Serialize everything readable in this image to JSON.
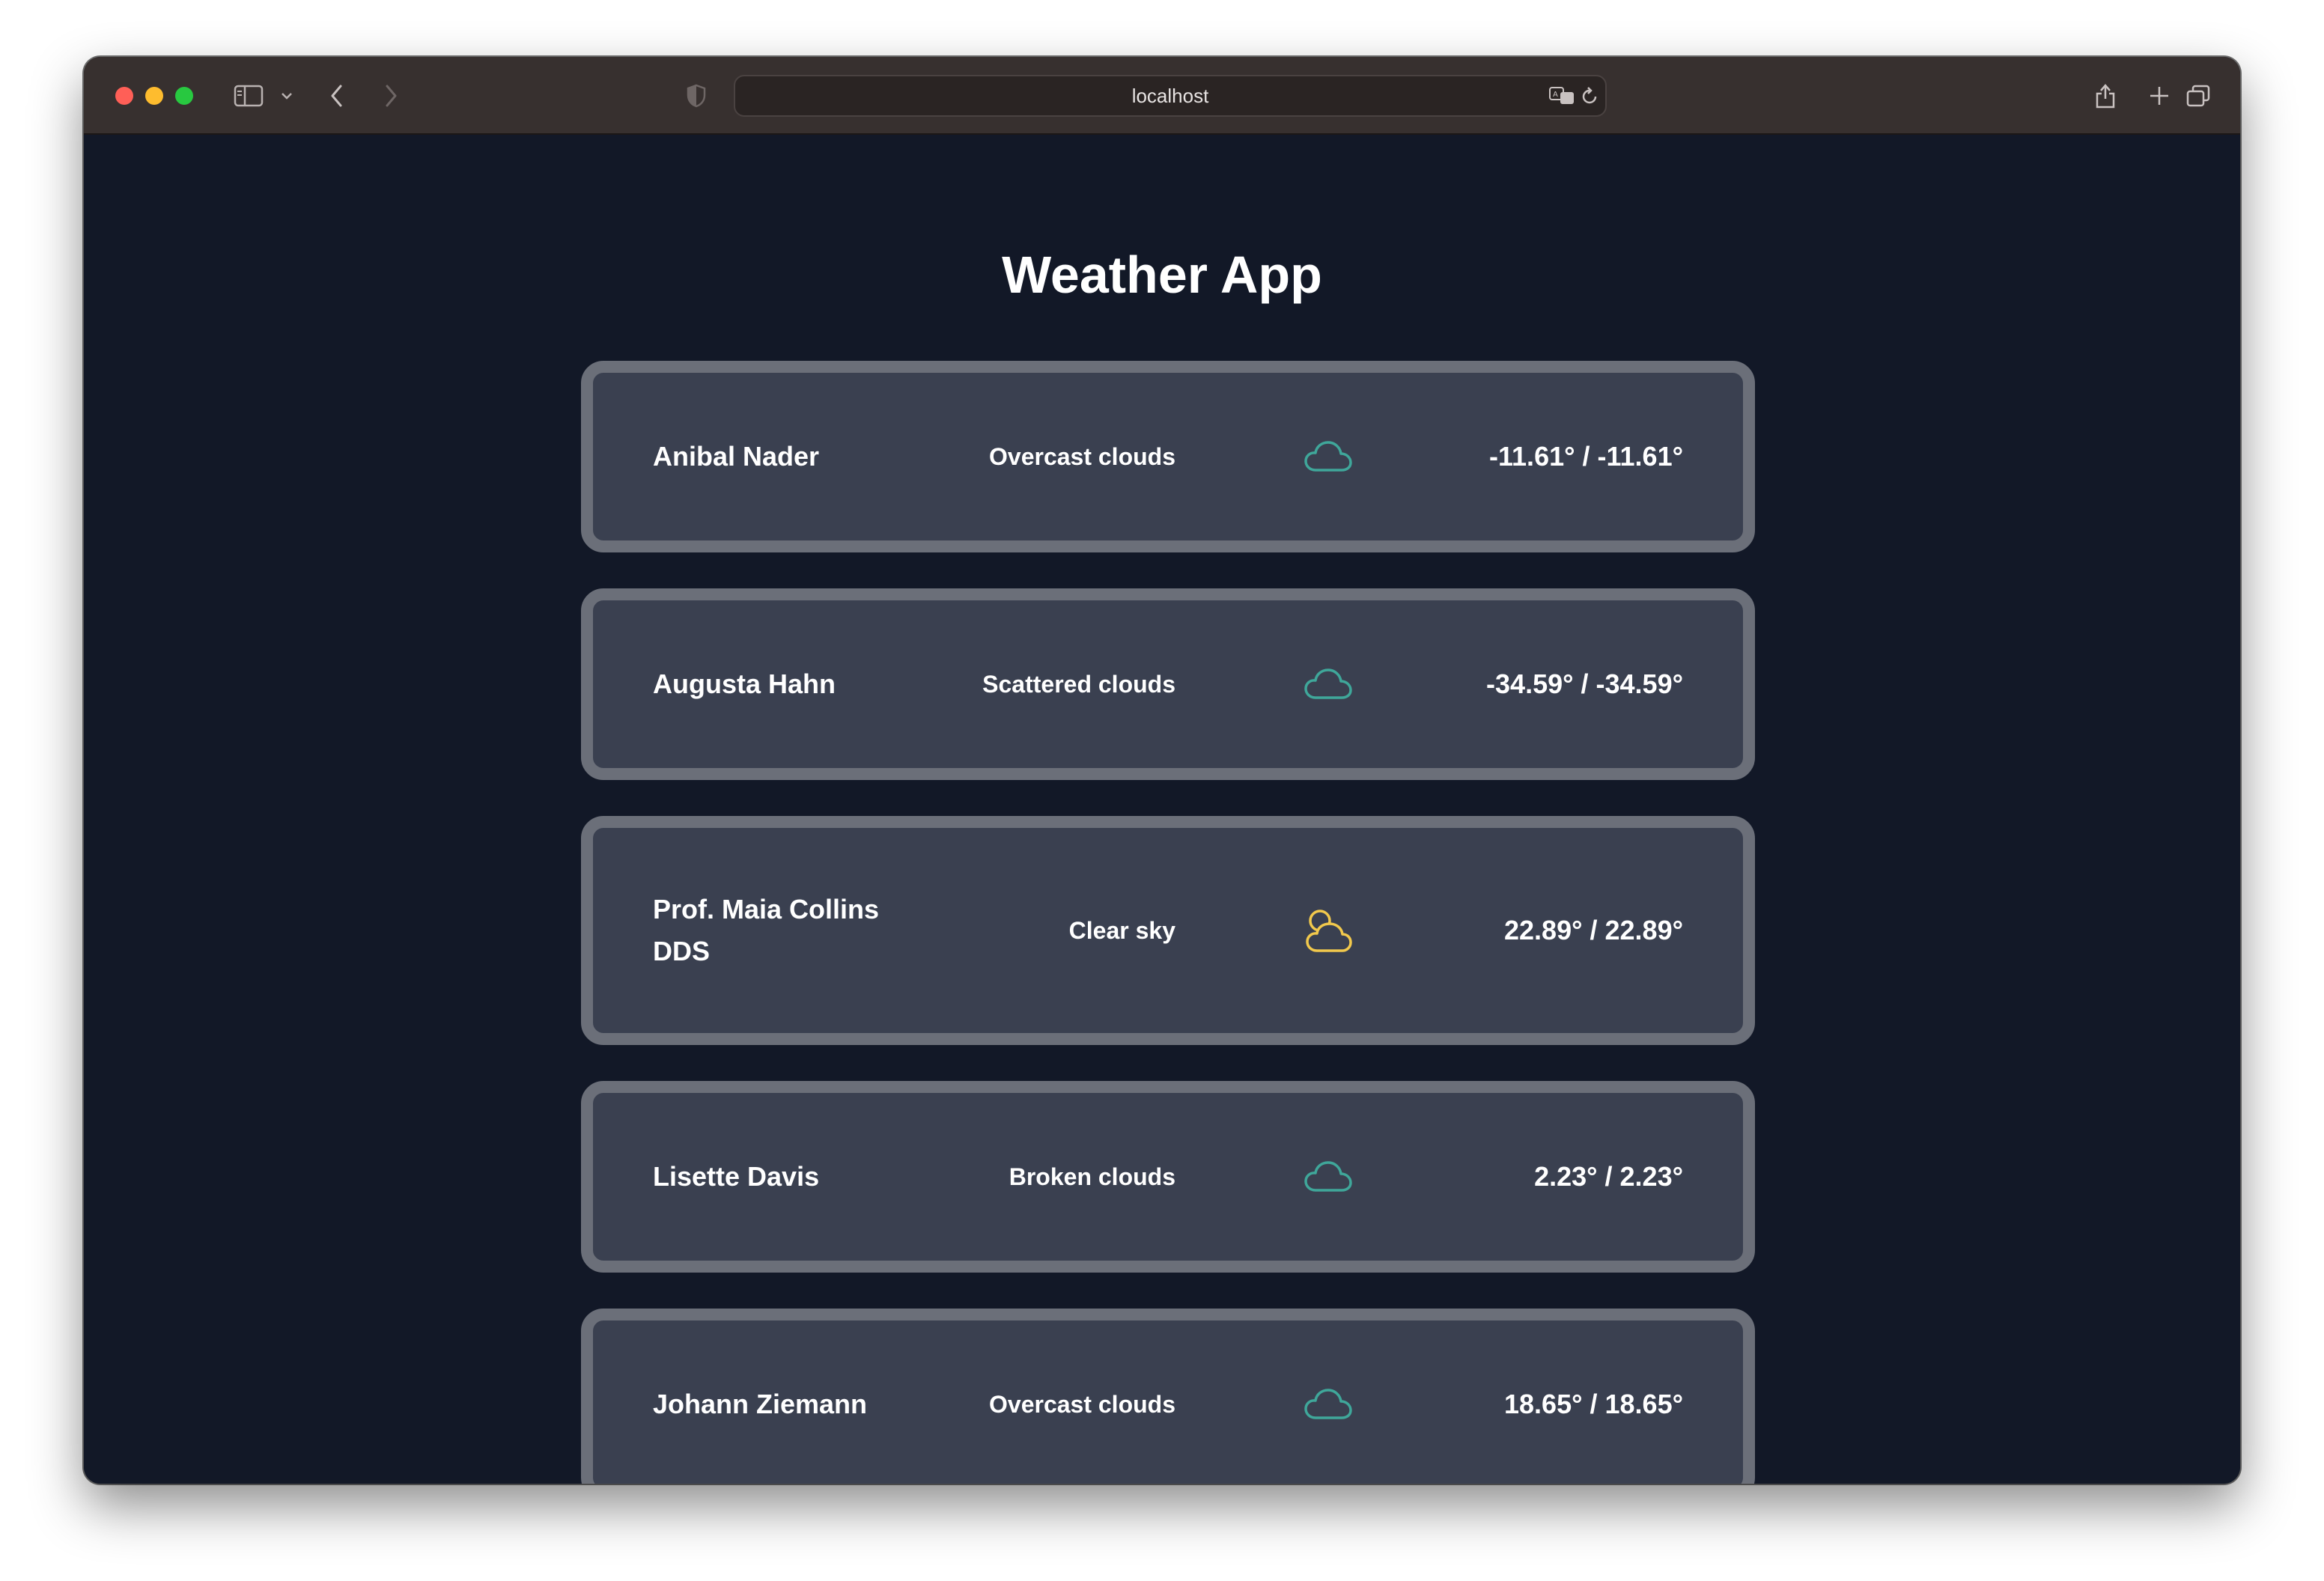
{
  "browser": {
    "address": "localhost"
  },
  "page": {
    "title": "Weather App"
  },
  "cities": [
    {
      "name": "Anibal Nader",
      "description": "Overcast clouds",
      "icon": "cloud-icon",
      "icon_color": "#3fa79a",
      "temperature": "-11.61° / -11.61°"
    },
    {
      "name": "Augusta Hahn",
      "description": "Scattered clouds",
      "icon": "cloud-icon",
      "icon_color": "#3fa79a",
      "temperature": "-34.59° / -34.59°"
    },
    {
      "name": "Prof. Maia Collins DDS",
      "description": "Clear sky",
      "icon": "sun-cloud-icon",
      "icon_color": "#f2c94c",
      "temperature": "22.89° / 22.89°"
    },
    {
      "name": "Lisette Davis",
      "description": "Broken clouds",
      "icon": "cloud-icon",
      "icon_color": "#3fa79a",
      "temperature": "2.23° / 2.23°"
    },
    {
      "name": "Johann Ziemann",
      "description": "Overcast clouds",
      "icon": "cloud-icon",
      "icon_color": "#3fa79a",
      "temperature": "18.65° / 18.65°"
    }
  ]
}
